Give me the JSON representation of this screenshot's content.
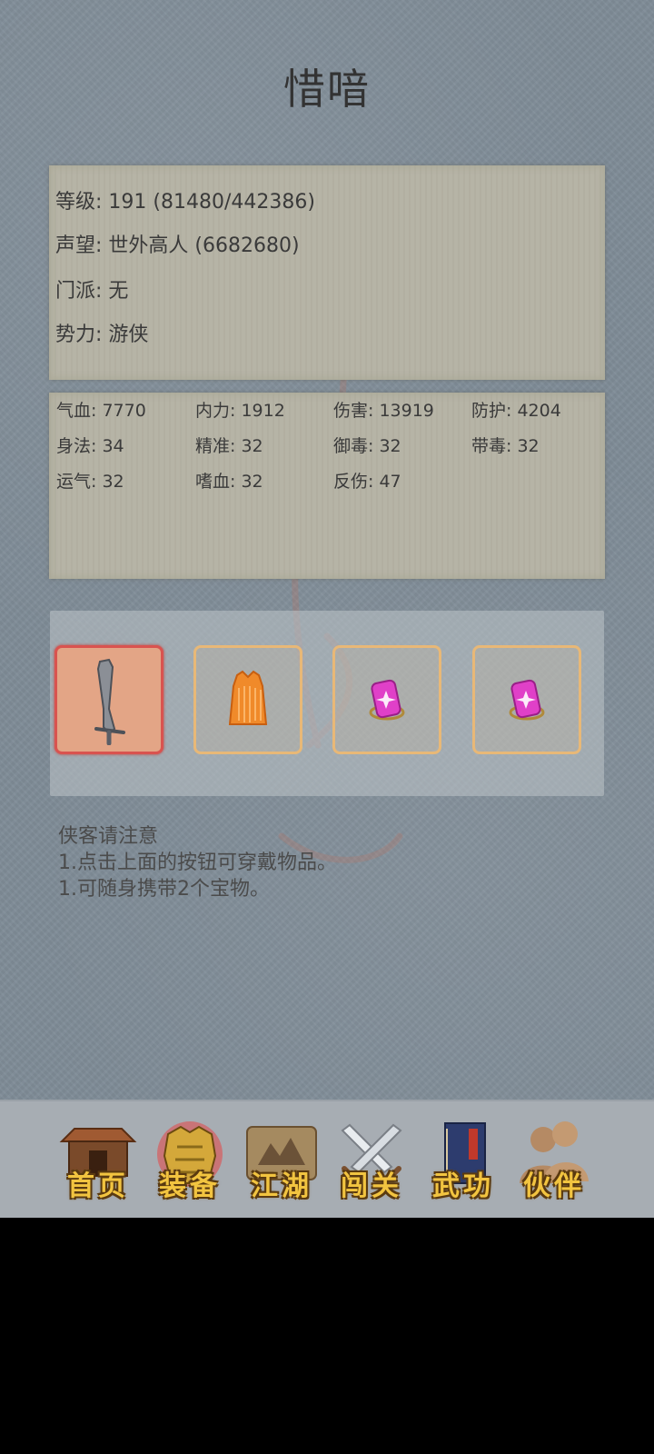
{
  "title": "惜喑",
  "info": {
    "level": "等级: 191 (81480/442386)",
    "reputation": "声望: 世外高人 (6682680)",
    "sect": "门派: 无",
    "faction": "势力:  游侠"
  },
  "stats": [
    "气血: 7770",
    "内力: 1912",
    "伤害: 13919",
    "防护: 4204",
    "身法: 34",
    "精准: 32",
    "御毒: 32",
    "带毒: 32",
    "运气: 32",
    "嗜血: 32",
    "反伤: 47"
  ],
  "equipment": [
    {
      "icon": "sword-icon",
      "state": "selected"
    },
    {
      "icon": "armor-icon",
      "state": "normal"
    },
    {
      "icon": "gem-icon",
      "state": "normal"
    },
    {
      "icon": "gem-icon",
      "state": "normal"
    }
  ],
  "notes": {
    "heading": "侠客请注意",
    "line1": "1.点击上面的按钮可穿戴物品。",
    "line2": "1.可随身携带2个宝物。"
  },
  "nav": [
    {
      "label": "首页",
      "icon": "house-icon"
    },
    {
      "label": "装备",
      "icon": "armor-icon",
      "active": true
    },
    {
      "label": "江湖",
      "icon": "map-scroll-icon"
    },
    {
      "label": "闯关",
      "icon": "crossed-swords-icon"
    },
    {
      "label": "武功",
      "icon": "book-icon"
    },
    {
      "label": "伙伴",
      "icon": "companions-icon"
    }
  ],
  "colors": {
    "background": "#7f8c97",
    "panel": "#b5b2a4",
    "slot_border": "#e8b877",
    "slot_selected_border": "#d9534f",
    "nav_label": "#f2c440"
  }
}
